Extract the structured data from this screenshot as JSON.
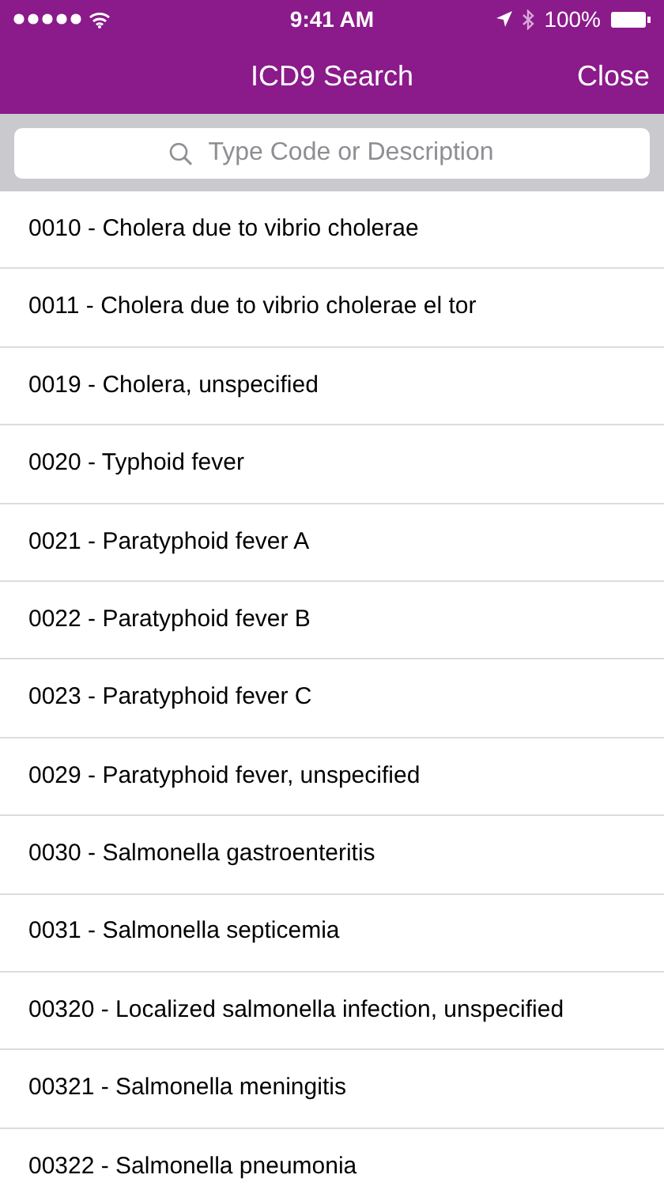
{
  "status_bar": {
    "time": "9:41 AM",
    "battery": "100%"
  },
  "nav": {
    "title": "ICD9 Search",
    "close": "Close"
  },
  "search": {
    "placeholder": "Type Code or Description"
  },
  "rows": [
    {
      "text": "0010 - Cholera due to vibrio cholerae"
    },
    {
      "text": "0011 - Cholera due to vibrio cholerae el tor"
    },
    {
      "text": "0019 - Cholera, unspecified"
    },
    {
      "text": "0020 - Typhoid fever"
    },
    {
      "text": "0021 - Paratyphoid fever A"
    },
    {
      "text": "0022 - Paratyphoid fever B"
    },
    {
      "text": "0023 - Paratyphoid fever C"
    },
    {
      "text": "0029 - Paratyphoid fever, unspecified"
    },
    {
      "text": "0030 - Salmonella gastroenteritis"
    },
    {
      "text": "0031 - Salmonella septicemia"
    },
    {
      "text": "00320 - Localized salmonella infection, unspecified"
    },
    {
      "text": "00321 - Salmonella meningitis"
    },
    {
      "text": "00322 - Salmonella pneumonia"
    }
  ]
}
